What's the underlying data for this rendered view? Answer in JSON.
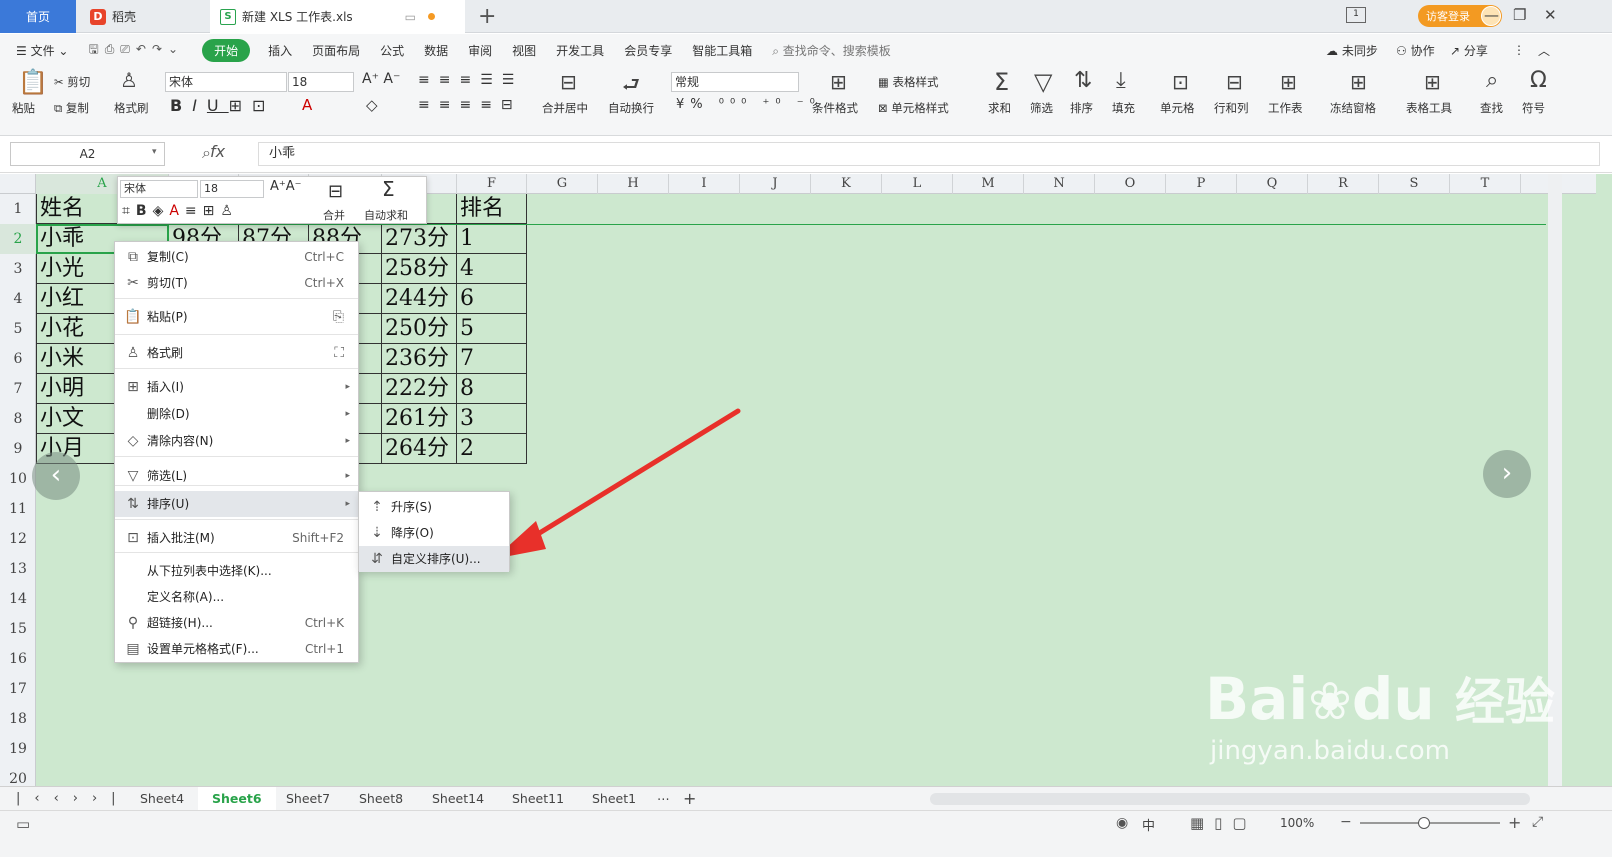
{
  "tabs": {
    "home": "首页",
    "daoke": "稻壳",
    "file": "新建 XLS 工作表.xls",
    "visitor": "访客登录"
  },
  "menu": {
    "file": "文件",
    "items": [
      "开始",
      "插入",
      "页面布局",
      "公式",
      "数据",
      "审阅",
      "视图",
      "开发工具",
      "会员专享",
      "智能工具箱"
    ],
    "search": "查找命令、搜索模板",
    "sync": "未同步",
    "collab": "协作",
    "share": "分享"
  },
  "ribbon": {
    "paste": "粘贴",
    "cut": "剪切",
    "copy": "复制",
    "format_painter": "格式刷",
    "font": "宋体",
    "size": "18",
    "merge": "合并居中",
    "wrap": "自动换行",
    "number_format": "常规",
    "cond_format": "条件格式",
    "table_style": "表格样式",
    "cell_style": "单元格样式",
    "sum": "求和",
    "filter": "筛选",
    "sort": "排序",
    "fill": "填充",
    "cell": "单元格",
    "rowcol": "行和列",
    "worksheet": "工作表",
    "freeze": "冻结窗格",
    "table_tools": "表格工具",
    "find": "查找",
    "symbol": "符号"
  },
  "formula": {
    "namebox": "A2",
    "fx": "fx",
    "value": "小乖"
  },
  "columns": [
    "A",
    "B",
    "C",
    "D",
    "E",
    "F",
    "G",
    "H",
    "I",
    "J",
    "K",
    "L",
    "M",
    "N",
    "O",
    "P",
    "Q",
    "R",
    "S",
    "T"
  ],
  "rows": [
    "1",
    "2",
    "3",
    "4",
    "5",
    "6",
    "7",
    "8",
    "9",
    "10",
    "11",
    "12",
    "13",
    "14",
    "15",
    "16",
    "17",
    "18",
    "19",
    "20"
  ],
  "table": {
    "header": [
      "姓名",
      "",
      "",
      "",
      "分",
      "排名"
    ],
    "data": [
      [
        "小乖",
        "98分",
        "87分",
        "88分",
        "273分",
        "1"
      ],
      [
        "小光",
        "",
        "",
        "",
        "258分",
        "4"
      ],
      [
        "小红",
        "",
        "",
        "",
        "244分",
        "6"
      ],
      [
        "小花",
        "",
        "",
        "",
        "250分",
        "5"
      ],
      [
        "小米",
        "",
        "",
        "",
        "236分",
        "7"
      ],
      [
        "小明",
        "",
        "",
        "",
        "222分",
        "8"
      ],
      [
        "小文",
        "",
        "",
        "",
        "261分",
        "3"
      ],
      [
        "小月",
        "",
        "",
        "",
        "264分",
        "2"
      ]
    ]
  },
  "minibar": {
    "font": "宋体",
    "size": "18",
    "merge": "合并",
    "autosum": "自动求和"
  },
  "context_menu": [
    {
      "label": "复制(C)",
      "shortcut": "Ctrl+C",
      "icon": "copy-icon"
    },
    {
      "label": "剪切(T)",
      "shortcut": "Ctrl+X",
      "icon": "scissors-icon"
    },
    {
      "label": "粘贴(P)",
      "shortcut": "",
      "icon": "paste-icon"
    },
    {
      "label": "格式刷",
      "shortcut": "",
      "icon": "brush-icon"
    },
    {
      "label": "插入(I)",
      "shortcut": "",
      "icon": "insert-icon"
    },
    {
      "label": "删除(D)",
      "shortcut": "",
      "icon": ""
    },
    {
      "label": "清除内容(N)",
      "shortcut": "",
      "icon": "eraser-icon"
    },
    {
      "label": "筛选(L)",
      "shortcut": "",
      "icon": "filter-icon"
    },
    {
      "label": "排序(U)",
      "shortcut": "",
      "icon": "sort-icon"
    },
    {
      "label": "插入批注(M)",
      "shortcut": "Shift+F2",
      "icon": "comment-icon"
    },
    {
      "label": "从下拉列表中选择(K)...",
      "shortcut": "",
      "icon": ""
    },
    {
      "label": "定义名称(A)...",
      "shortcut": "",
      "icon": ""
    },
    {
      "label": "超链接(H)...",
      "shortcut": "Ctrl+K",
      "icon": "link-icon"
    },
    {
      "label": "设置单元格格式(F)...",
      "shortcut": "Ctrl+1",
      "icon": "format-cells-icon"
    }
  ],
  "submenu": [
    {
      "label": "升序(S)"
    },
    {
      "label": "降序(O)"
    },
    {
      "label": "自定义排序(U)..."
    }
  ],
  "sheets": [
    "Sheet4",
    "Sheet6",
    "Sheet7",
    "Sheet8",
    "Sheet14",
    "Sheet11",
    "Sheet1"
  ],
  "active_sheet": "Sheet6",
  "status": {
    "zoom": "100%",
    "input_mode": "中"
  },
  "watermark": {
    "brand": "Bai",
    "brand2": "du",
    "cn": "经验",
    "url": "jingyan.baidu.com"
  },
  "colors": {
    "accent": "#29a34a",
    "sheet_bg": "#cde8cf",
    "arrow": "#e8302a"
  }
}
